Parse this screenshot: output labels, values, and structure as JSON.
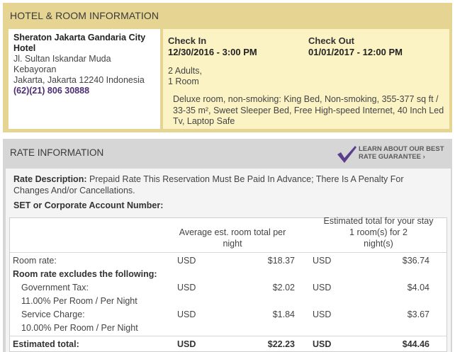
{
  "hotel_section": {
    "title": "HOTEL & ROOM INFORMATION",
    "hotel_name": "Sheraton Jakarta Gandaria City Hotel",
    "address_lines": [
      "Jl. Sultan Iskandar Muda",
      "Kebayoran",
      "Jakarta, Jakarta 12240 Indonesia"
    ],
    "phone": "(62)(21) 806 30888",
    "check_in_label": "Check In",
    "check_in_value": "12/30/2016 - 3:00 PM",
    "check_out_label": "Check Out",
    "check_out_value": "01/01/2017 - 12:00 PM",
    "guests": "2 Adults,",
    "rooms": "1 Room",
    "room_description": "Deluxe room, non-smoking: King Bed,  Non-smoking,  355-377 sq ft / 33-35 m²,  Sweet Sleeper Bed,  Free High-speed Internet, 40 Inch Led Tv,  Laptop Safe"
  },
  "rate_section": {
    "title": "RATE INFORMATION",
    "guarantee_line1": "LEARN ABOUT OUR BEST",
    "guarantee_line2": "RATE GUARANTEE",
    "guarantee_arrow": "›",
    "rate_description_label": "Rate Description:",
    "rate_description_text": "Prepaid Rate This Reservation Must Be Paid In Advance; There Is A Penalty For Changes And/or Cancellations.",
    "corporate_label": "SET or Corporate Account Number:",
    "table": {
      "col_avg_header_line1": "Average est. room total per",
      "col_avg_header_line2": "night",
      "col_total_header_line1": "Estimated total for your stay",
      "col_total_header_line2": "1 room(s) for 2",
      "col_total_header_line3": "night(s)",
      "room_rate_label": "Room rate:",
      "excludes_label": "Room rate excludes the following:",
      "gov_tax_label": "Government Tax:",
      "gov_tax_detail": "11.00% Per Room / Per Night",
      "service_label": "Service Charge:",
      "service_detail": "10.00% Per Room / Per Night",
      "total_label": "Estimated total:",
      "currency": "USD",
      "room_rate_avg": "$18.37",
      "room_rate_total": "$36.74",
      "gov_tax_avg": "$2.02",
      "gov_tax_total": "$4.04",
      "service_avg": "$1.84",
      "service_total": "$3.67",
      "estimated_avg": "$22.23",
      "estimated_total": "$44.46"
    }
  },
  "colors": {
    "hotel_panel_bg": "#e6d492",
    "stay_panel_bg": "#fcf3c4",
    "rate_panel_bg": "#d6d6d6",
    "phone_color": "#4b2d73",
    "guarantee_check": "#5b3f8c"
  },
  "icons": {
    "guarantee_icon": "purple-check-icon"
  }
}
